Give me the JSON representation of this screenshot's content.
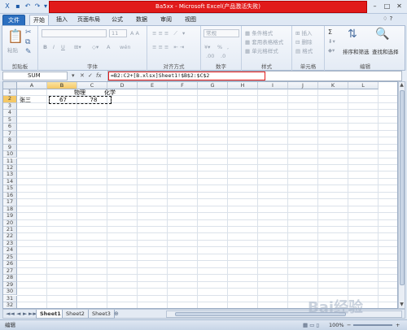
{
  "window": {
    "title": "Ba5xx - Microsoft Excel(产品激活失败)",
    "min": "–",
    "max": "□",
    "close": "✕"
  },
  "quick_access": [
    "excel-logo-icon",
    "save-icon",
    "undo-icon",
    "redo-icon",
    "dropdown-icon"
  ],
  "tabs": {
    "file": "文件",
    "items": [
      "开始",
      "插入",
      "页面布局",
      "公式",
      "数据",
      "审阅",
      "视图"
    ],
    "active": "开始",
    "help": "♢ ?"
  },
  "ribbon": {
    "clipboard": {
      "label": "剪贴板",
      "paste": "粘贴"
    },
    "font": {
      "label": "字体",
      "size": "11",
      "bold": "B",
      "italic": "I",
      "underline": "U",
      "font_a": "A",
      "wen": "wén"
    },
    "alignment": {
      "label": "对齐方式"
    },
    "number": {
      "label": "数字",
      "format": "常规",
      "percent": "%",
      "comma": ",",
      "dec1": ".00",
      "dec2": ".0"
    },
    "styles": {
      "label": "样式",
      "items": [
        "条件格式",
        "套用表格格式",
        "单元格样式"
      ]
    },
    "cells": {
      "label": "单元格",
      "items": [
        "插入",
        "删除",
        "格式"
      ]
    },
    "editing": {
      "label": "编辑",
      "sort": "排序和筛选",
      "find": "查找和选择",
      "sigma": "Σ"
    }
  },
  "formula_bar": {
    "name_box": "SUM",
    "cancel": "✕",
    "enter": "✓",
    "fx": "fx",
    "formula": "=B2:C2+[B.xlsx]Sheet1!$B$2:$C$2"
  },
  "grid": {
    "columns": [
      "A",
      "B",
      "C",
      "D",
      "E",
      "F",
      "G",
      "H",
      "I",
      "J",
      "K",
      "L"
    ],
    "rows": [
      "1",
      "2",
      "3",
      "4",
      "5",
      "6",
      "7",
      "8",
      "9",
      "10",
      "11",
      "12",
      "13",
      "14",
      "15",
      "16",
      "17",
      "18",
      "19",
      "20",
      "21",
      "22",
      "23",
      "24",
      "25",
      "26",
      "27",
      "28",
      "29",
      "30",
      "31",
      "32"
    ],
    "selected_column": "B",
    "selected_row": "2",
    "cells": {
      "B1": "物理",
      "C1": "化学",
      "A2": "张三",
      "B2": "67",
      "C2": "78"
    }
  },
  "sheets": {
    "tabs": [
      "Sheet1",
      "Sheet2",
      "Sheet3"
    ],
    "active": "Sheet1",
    "nav": [
      "◄◄",
      "◄",
      "►",
      "►►"
    ]
  },
  "status_bar": {
    "mode": "编辑",
    "zoom": "100%",
    "zoom_out": "−",
    "zoom_in": "+"
  },
  "watermark": "Bai经验"
}
